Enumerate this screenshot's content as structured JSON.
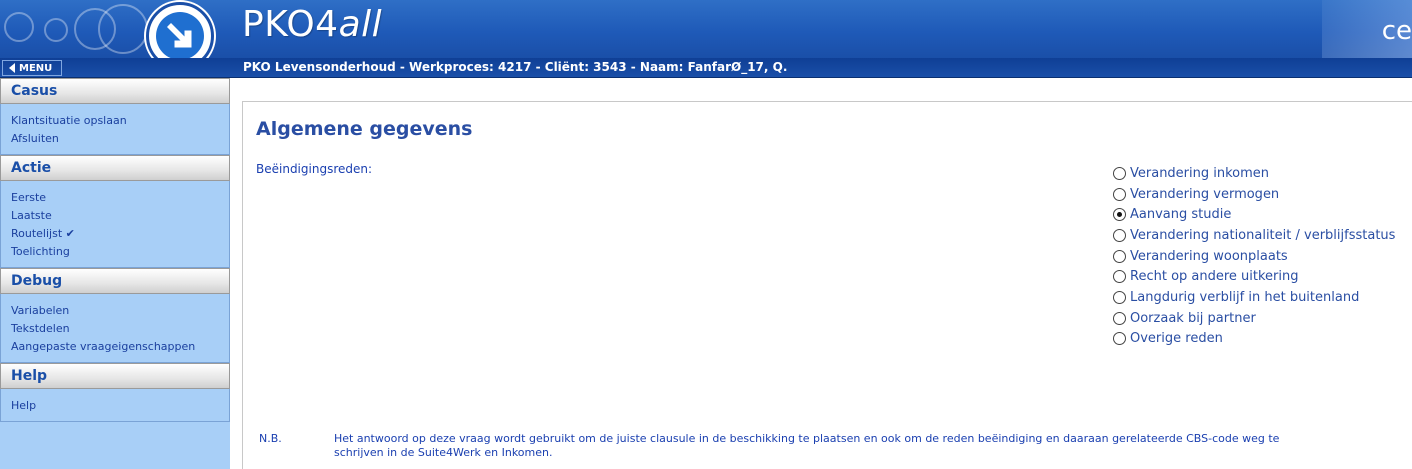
{
  "header": {
    "app_title_main": "PKO4",
    "app_title_italic": "all",
    "corner_text": "ce",
    "menu_label": "MENU",
    "breadcrumb": "PKO Levensonderhoud - Werkproces: 4217 - Cliënt: 3543 - Naam: FanfarØ_17, Q."
  },
  "sidebar": {
    "sections": [
      {
        "title": "Casus",
        "items": [
          "Klantsituatie opslaan",
          "Afsluiten"
        ]
      },
      {
        "title": "Actie",
        "items": [
          "Eerste",
          "Laatste",
          "Routelijst ✔",
          "Toelichting"
        ]
      },
      {
        "title": "Debug",
        "items": [
          "Variabelen",
          "Tekstdelen",
          "Aangepaste vraageigenschappen"
        ]
      },
      {
        "title": "Help",
        "items": [
          "Help"
        ]
      }
    ]
  },
  "main": {
    "title": "Algemene gegevens",
    "question_label": "Beëindigingsreden:",
    "options": [
      {
        "label": "Verandering inkomen",
        "checked": false
      },
      {
        "label": "Verandering vermogen",
        "checked": false
      },
      {
        "label": "Aanvang studie",
        "checked": true
      },
      {
        "label": "Verandering nationaliteit / verblijfsstatus",
        "checked": false
      },
      {
        "label": "Verandering woonplaats",
        "checked": false
      },
      {
        "label": "Recht op andere uitkering",
        "checked": false
      },
      {
        "label": "Langdurig verblijf in het buitenland",
        "checked": false
      },
      {
        "label": "Oorzaak bij partner",
        "checked": false
      },
      {
        "label": "Overige reden",
        "checked": false
      }
    ],
    "nb_label": "N.B.",
    "nb_text": "Het antwoord op deze vraag wordt gebruikt om de juiste clausule in de beschikking te plaatsen en ook om de reden beëindiging en daaraan gerelateerde CBS-code weg te schrijven in de Suite4Werk en Inkomen."
  },
  "colors": {
    "banner_blue": "#1f5ab8",
    "sidebar_bg": "#a8cff7",
    "link_blue": "#1a3f9e",
    "title_blue": "#2a4ea3"
  }
}
